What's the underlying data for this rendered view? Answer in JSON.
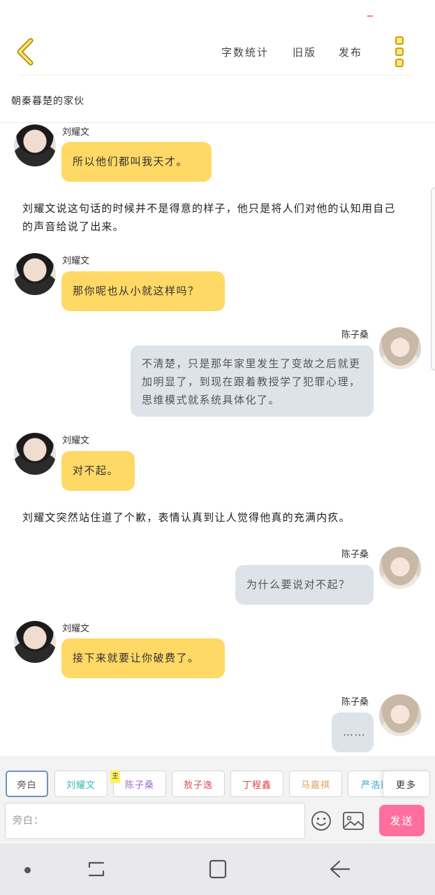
{
  "toolbar": {
    "word_count": "字数统计",
    "old_version": "旧版",
    "publish": "发布",
    "accent_color": "#ffe680"
  },
  "book": {
    "title": "朝秦暮楚的家伙"
  },
  "messages": [
    {
      "type": "left",
      "speaker": "刘耀文",
      "text": "所以他们都叫我天才。"
    },
    {
      "type": "narration",
      "text": "刘耀文说这句话的时候并不是得意的样子，他只是将人们对他的认知用自己的声音给说了出来。"
    },
    {
      "type": "left",
      "speaker": "刘耀文",
      "text": "那你呢也从小就这样吗？"
    },
    {
      "type": "right",
      "speaker": "陈子桑",
      "text": "不清楚，只是那年家里发生了变故之后就更加明显了，到现在跟着教授学了犯罪心理，思维模式就系统具体化了。"
    },
    {
      "type": "left",
      "speaker": "刘耀文",
      "text": "对不起。"
    },
    {
      "type": "narration",
      "text": "刘耀文突然站住道了个歉，表情认真到让人觉得他真的充满内疚。"
    },
    {
      "type": "right",
      "speaker": "陈子桑",
      "text": "为什么要说对不起？"
    },
    {
      "type": "left",
      "speaker": "刘耀文",
      "text": "接下来就要让你破费了。"
    },
    {
      "type": "right",
      "speaker": "陈子桑",
      "text": "……"
    }
  ],
  "roles": [
    {
      "label": "旁白",
      "color": "#666666",
      "active": true
    },
    {
      "label": "刘耀文",
      "color": "#3bb6b0"
    },
    {
      "label": "陈子桑",
      "color": "#9b6bd6",
      "badge": "主"
    },
    {
      "label": "敖子逸",
      "color": "#e0505a"
    },
    {
      "label": "丁程鑫",
      "color": "#e0404a"
    },
    {
      "label": "马嘉祺",
      "color": "#e89a5a"
    },
    {
      "label": "严浩翔",
      "color": "#3aa6c8"
    }
  ],
  "roles_more": "更多",
  "input": {
    "placeholder": "旁白：",
    "value": ""
  },
  "send_label": "发送",
  "send_color": "#ff6f9e"
}
